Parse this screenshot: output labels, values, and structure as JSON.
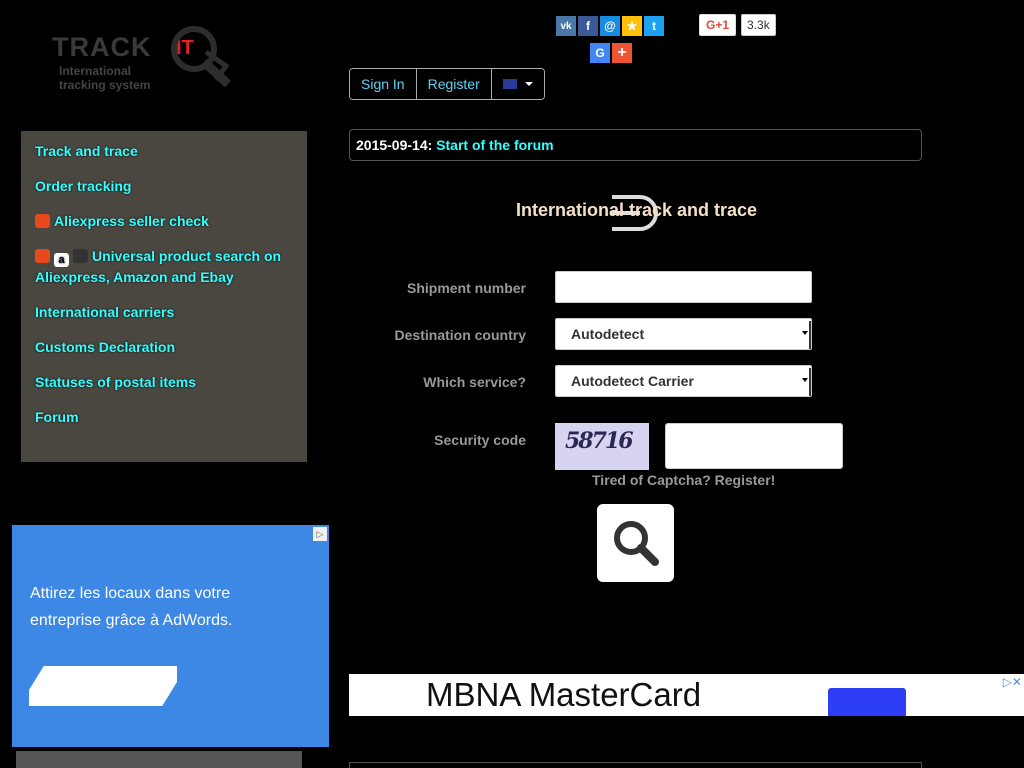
{
  "logo": {
    "brand": "TRACK",
    "brand_suffix": "IT",
    "tagline_line1": "International",
    "tagline_line2": "tracking system"
  },
  "social": {
    "icons": [
      "vk-icon",
      "facebook-icon",
      "mail-icon",
      "star-icon",
      "twitter-icon",
      "google-icon",
      "plus-icon"
    ],
    "vk": "vk",
    "fb": "f",
    "mail": "@",
    "star": "★",
    "tw": "t",
    "g": "G",
    "plus": "+"
  },
  "gplus": {
    "label": "G+1",
    "count": "3.3k"
  },
  "auth": {
    "sign_in": "Sign In",
    "register": "Register"
  },
  "sidebar": {
    "items": [
      {
        "label": "Track and trace"
      },
      {
        "label": "Order tracking"
      },
      {
        "label": "Aliexpress seller check"
      },
      {
        "label": "Universal product search on Aliexpress, Amazon and Ebay"
      },
      {
        "label": "International carriers"
      },
      {
        "label": "Customs Declaration"
      },
      {
        "label": "Statuses of postal items"
      },
      {
        "label": "Forum"
      }
    ]
  },
  "ad_left": {
    "text": "Attirez les locaux dans votre entreprise grâce à AdWords."
  },
  "news": {
    "date": "2015-09-14:",
    "link": "Start of the forum"
  },
  "form": {
    "title": "International track and trace",
    "shipment_label": "Shipment number",
    "destination_label": "Destination country",
    "destination_value": "Autodetect",
    "service_label": "Which service?",
    "service_value": "Autodetect Carrier",
    "security_label": "Security code",
    "captcha_text": "58716",
    "tired": "Tired of Captcha? Register!"
  },
  "ad_banner": {
    "text": "MBNA MasterCard"
  },
  "colors": {
    "link": "#33ffff",
    "sidebar_bg": "#4a4640",
    "ad_blue": "#3d87e5"
  }
}
